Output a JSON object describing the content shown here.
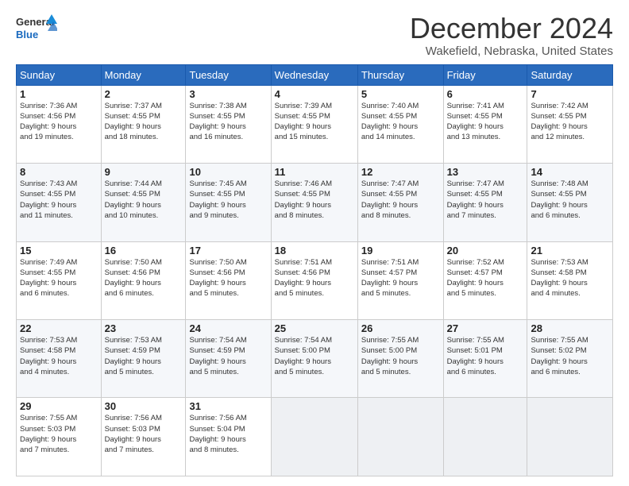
{
  "logo": {
    "line1": "General",
    "line2": "Blue"
  },
  "title": "December 2024",
  "subtitle": "Wakefield, Nebraska, United States",
  "days_of_week": [
    "Sunday",
    "Monday",
    "Tuesday",
    "Wednesday",
    "Thursday",
    "Friday",
    "Saturday"
  ],
  "weeks": [
    [
      {
        "day": "1",
        "sunrise": "7:36 AM",
        "sunset": "4:56 PM",
        "daylight_h": "9",
        "daylight_m": "19"
      },
      {
        "day": "2",
        "sunrise": "7:37 AM",
        "sunset": "4:55 PM",
        "daylight_h": "9",
        "daylight_m": "18"
      },
      {
        "day": "3",
        "sunrise": "7:38 AM",
        "sunset": "4:55 PM",
        "daylight_h": "9",
        "daylight_m": "16"
      },
      {
        "day": "4",
        "sunrise": "7:39 AM",
        "sunset": "4:55 PM",
        "daylight_h": "9",
        "daylight_m": "15"
      },
      {
        "day": "5",
        "sunrise": "7:40 AM",
        "sunset": "4:55 PM",
        "daylight_h": "9",
        "daylight_m": "14"
      },
      {
        "day": "6",
        "sunrise": "7:41 AM",
        "sunset": "4:55 PM",
        "daylight_h": "9",
        "daylight_m": "13"
      },
      {
        "day": "7",
        "sunrise": "7:42 AM",
        "sunset": "4:55 PM",
        "daylight_h": "9",
        "daylight_m": "12"
      }
    ],
    [
      {
        "day": "8",
        "sunrise": "7:43 AM",
        "sunset": "4:55 PM",
        "daylight_h": "9",
        "daylight_m": "11"
      },
      {
        "day": "9",
        "sunrise": "7:44 AM",
        "sunset": "4:55 PM",
        "daylight_h": "9",
        "daylight_m": "10"
      },
      {
        "day": "10",
        "sunrise": "7:45 AM",
        "sunset": "4:55 PM",
        "daylight_h": "9",
        "daylight_m": "9"
      },
      {
        "day": "11",
        "sunrise": "7:46 AM",
        "sunset": "4:55 PM",
        "daylight_h": "9",
        "daylight_m": "8"
      },
      {
        "day": "12",
        "sunrise": "7:47 AM",
        "sunset": "4:55 PM",
        "daylight_h": "9",
        "daylight_m": "8"
      },
      {
        "day": "13",
        "sunrise": "7:47 AM",
        "sunset": "4:55 PM",
        "daylight_h": "9",
        "daylight_m": "7"
      },
      {
        "day": "14",
        "sunrise": "7:48 AM",
        "sunset": "4:55 PM",
        "daylight_h": "9",
        "daylight_m": "6"
      }
    ],
    [
      {
        "day": "15",
        "sunrise": "7:49 AM",
        "sunset": "4:55 PM",
        "daylight_h": "9",
        "daylight_m": "6"
      },
      {
        "day": "16",
        "sunrise": "7:50 AM",
        "sunset": "4:56 PM",
        "daylight_h": "9",
        "daylight_m": "6"
      },
      {
        "day": "17",
        "sunrise": "7:50 AM",
        "sunset": "4:56 PM",
        "daylight_h": "9",
        "daylight_m": "5"
      },
      {
        "day": "18",
        "sunrise": "7:51 AM",
        "sunset": "4:56 PM",
        "daylight_h": "9",
        "daylight_m": "5"
      },
      {
        "day": "19",
        "sunrise": "7:51 AM",
        "sunset": "4:57 PM",
        "daylight_h": "9",
        "daylight_m": "5"
      },
      {
        "day": "20",
        "sunrise": "7:52 AM",
        "sunset": "4:57 PM",
        "daylight_h": "9",
        "daylight_m": "5"
      },
      {
        "day": "21",
        "sunrise": "7:53 AM",
        "sunset": "4:58 PM",
        "daylight_h": "9",
        "daylight_m": "4"
      }
    ],
    [
      {
        "day": "22",
        "sunrise": "7:53 AM",
        "sunset": "4:58 PM",
        "daylight_h": "9",
        "daylight_m": "4"
      },
      {
        "day": "23",
        "sunrise": "7:53 AM",
        "sunset": "4:59 PM",
        "daylight_h": "9",
        "daylight_m": "5"
      },
      {
        "day": "24",
        "sunrise": "7:54 AM",
        "sunset": "4:59 PM",
        "daylight_h": "9",
        "daylight_m": "5"
      },
      {
        "day": "25",
        "sunrise": "7:54 AM",
        "sunset": "5:00 PM",
        "daylight_h": "9",
        "daylight_m": "5"
      },
      {
        "day": "26",
        "sunrise": "7:55 AM",
        "sunset": "5:00 PM",
        "daylight_h": "9",
        "daylight_m": "5"
      },
      {
        "day": "27",
        "sunrise": "7:55 AM",
        "sunset": "5:01 PM",
        "daylight_h": "9",
        "daylight_m": "6"
      },
      {
        "day": "28",
        "sunrise": "7:55 AM",
        "sunset": "5:02 PM",
        "daylight_h": "9",
        "daylight_m": "6"
      }
    ],
    [
      {
        "day": "29",
        "sunrise": "7:55 AM",
        "sunset": "5:03 PM",
        "daylight_h": "9",
        "daylight_m": "7"
      },
      {
        "day": "30",
        "sunrise": "7:56 AM",
        "sunset": "5:03 PM",
        "daylight_h": "9",
        "daylight_m": "7"
      },
      {
        "day": "31",
        "sunrise": "7:56 AM",
        "sunset": "5:04 PM",
        "daylight_h": "9",
        "daylight_m": "8"
      },
      null,
      null,
      null,
      null
    ]
  ]
}
